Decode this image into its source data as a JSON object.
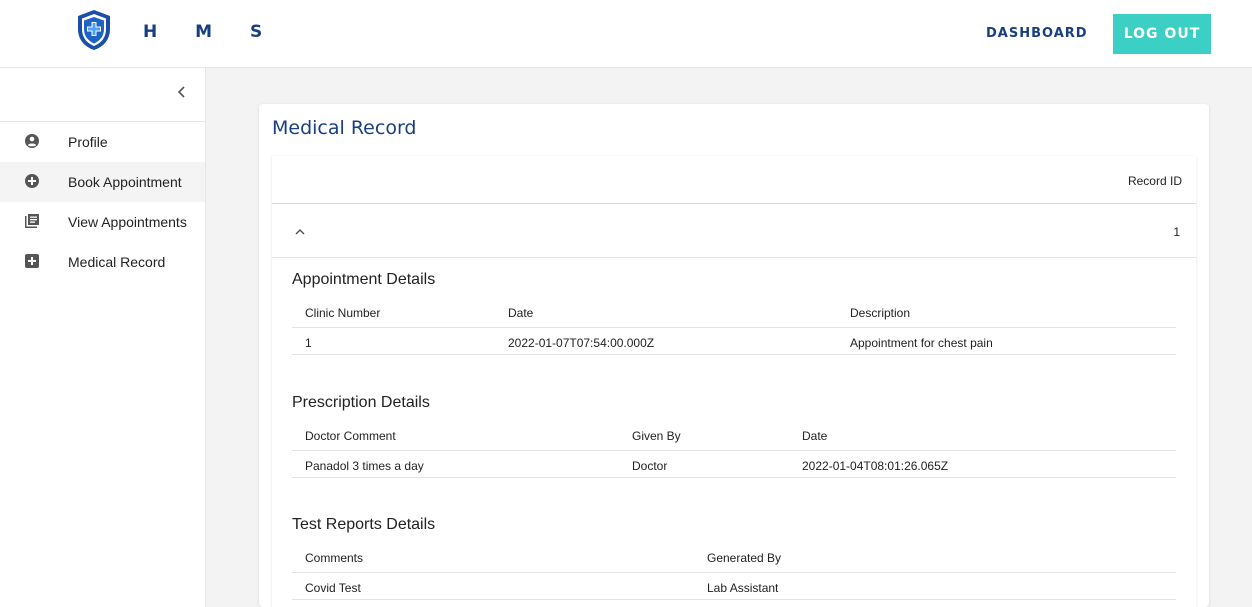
{
  "header": {
    "brand": "H M S",
    "nav_dashboard": "DASHBOARD",
    "logout_label": "LOG OUT",
    "accent": "#3ccfc6",
    "brand_color": "#1a3f80"
  },
  "sidebar": {
    "collapse_glyph": "‹",
    "items": [
      {
        "label": "Profile",
        "icon": "account-circle-icon"
      },
      {
        "label": "Book Appointment",
        "icon": "add-circle-icon",
        "active": true
      },
      {
        "label": "View Appointments",
        "icon": "library-books-icon"
      },
      {
        "label": "Medical Record",
        "icon": "add-box-icon"
      }
    ]
  },
  "main": {
    "title": "Medical Record",
    "table": {
      "header": "Record ID",
      "rows": [
        {
          "record_id": "1",
          "expanded": true
        }
      ]
    },
    "appointment": {
      "title": "Appointment Details",
      "columns": [
        "Clinic Number",
        "Date",
        "Description"
      ],
      "rows": [
        [
          "1",
          "2022-01-07T07:54:00.000Z",
          "Appointment for chest pain"
        ]
      ]
    },
    "prescription": {
      "title": "Prescription Details",
      "columns": [
        "Doctor Comment",
        "Given By",
        "Date"
      ],
      "rows": [
        [
          "Panadol 3 times a day",
          "Doctor",
          "2022-01-04T08:01:26.065Z"
        ]
      ]
    },
    "test_reports": {
      "title": "Test Reports Details",
      "columns": [
        "Comments",
        "Generated By"
      ],
      "rows": [
        [
          "Covid Test",
          "Lab Assistant"
        ]
      ]
    }
  }
}
